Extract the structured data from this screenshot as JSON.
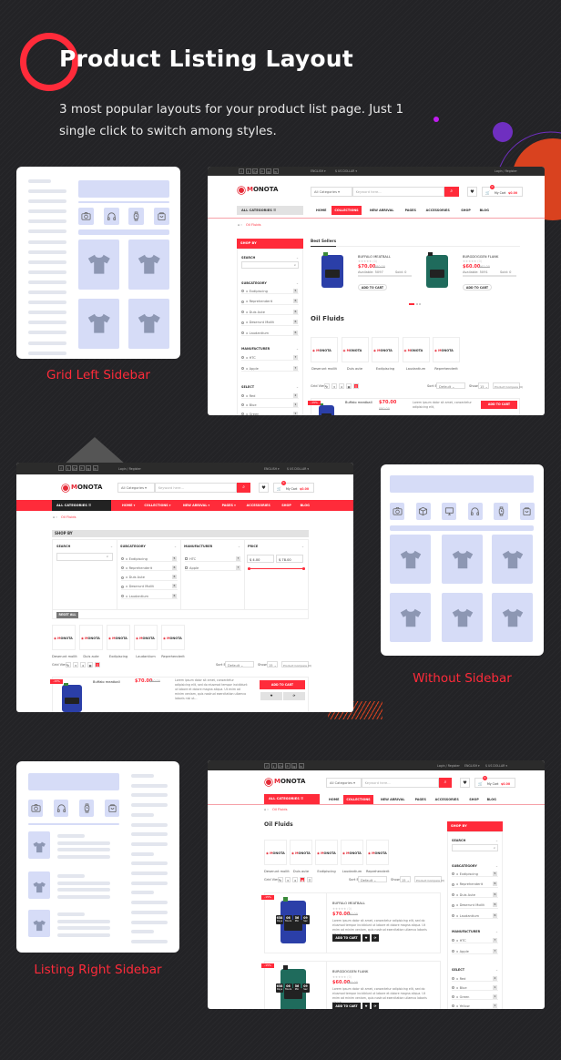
{
  "header": {
    "title": "Product Listing Layout",
    "subtitle": "3 most popular layouts for your product list page. Just 1 single click to switch among styles."
  },
  "colors": {
    "accent": "#ff2b3a",
    "wire": "#d6dcf7",
    "shirt": "#8d97b3",
    "purple": "#6f2fc0",
    "orange": "#d9421f"
  },
  "layouts": [
    {
      "label": "Grid Left Sidebar",
      "icons": [
        "camera-icon",
        "headphones-icon",
        "watch-icon",
        "bag-icon"
      ]
    },
    {
      "label": "Without Sidebar",
      "icons": [
        "camera-icon",
        "box-icon",
        "monitor-icon",
        "headphones-icon",
        "watch-icon",
        "bag-icon"
      ]
    },
    {
      "label": "Listing Right Sidebar",
      "icons": [
        "camera-icon",
        "headphones-icon",
        "watch-icon",
        "bag-icon"
      ]
    }
  ],
  "site": {
    "social": [
      "f",
      "t",
      "G+",
      "P",
      "ig",
      "in"
    ],
    "language": "ENGLISH",
    "currency": "$ US DOLLAR",
    "login": "Login / Register",
    "logo_m": "M",
    "logo_rest": "ONOTA",
    "category_select": "All Categories",
    "search_placeholder": "Keyword here...",
    "cart_label": "My Cart",
    "cart_total": "$0.00",
    "cart_count": "0",
    "all_categories": "ALL CATEGORIES",
    "nav": [
      "HOME",
      "COLLECTIONS",
      "NEW ARRIVAL",
      "PAGES",
      "ACCESSORIES",
      "SHOP",
      "BLOG"
    ],
    "breadcrumb": "Oil Fluids",
    "shop_by": "SHOP BY",
    "search": "SEARCH",
    "subcategory": "SUBCATEGORY",
    "manufacturer": "MANUFACTURER",
    "select": "SELECT",
    "price": "PRICE",
    "subcategories": [
      {
        "name": "Exdipiscing",
        "count": "5"
      },
      {
        "name": "Reprehenderit",
        "count": "6"
      },
      {
        "name": "Duis Aute",
        "count": "6"
      },
      {
        "name": "Deserunt Mollit",
        "count": "6"
      },
      {
        "name": "Laudantium",
        "count": "6"
      }
    ],
    "manufacturers": [
      {
        "name": "HTC",
        "count": "7"
      },
      {
        "name": "Apple",
        "count": "7"
      }
    ],
    "colors": [
      {
        "name": "Red",
        "count": "2"
      },
      {
        "name": "Blue",
        "count": "1"
      },
      {
        "name": "Green",
        "count": "1"
      },
      {
        "name": "Yellow",
        "count": "1"
      }
    ],
    "price_from": "$ 4.00",
    "price_to": "$ 78.00",
    "reset_all": "RESET ALL",
    "best_sellers": "Best Sellers",
    "page_title": "Oil Fluids",
    "brands_grid": [
      "Deserunt mollit",
      "Duis aute",
      "Exdipiscing",
      "Laudantium",
      "Reprehenderit"
    ],
    "grid_view": "Grid View:",
    "grid_options": [
      "2",
      "3",
      "4"
    ],
    "sort_by": "Sort By:",
    "sort_value": "Default",
    "show": "Show:",
    "show_value": "15",
    "compare": "Product Compare (0)",
    "add_to_cart": "ADD TO CART",
    "sale_badge": "-15%",
    "available_label": "Available:",
    "sold_label": "Sold:",
    "products": [
      {
        "name": "BUFFALO MEATBALL",
        "list_name": "Buffalo meatball",
        "price": "$70.00",
        "old_price": "$80.00",
        "rating_count": "(0)",
        "available": "5097",
        "sold": "0"
      },
      {
        "name": "BURGDOGGEN FLANK",
        "price": "$60.00",
        "old_price": "$61.00",
        "rating_count": "(0)",
        "available": "5091",
        "sold": "0"
      }
    ],
    "description_short": "Lorem ipsum dolor sit amet, consectetur adipisicing elit,",
    "description": "Lorem ipsum dolor sit amet, consectetur adipisicing elit, sed do eiusmod tempor incididunt ut labore et dolore magna aliqua. Ut enim ad minim veniam, quis nostrud exercitation ullamco laboris nisi ut...",
    "countdown": [
      {
        "v": "658",
        "u": "Days"
      },
      {
        "v": "06",
        "u": "Hours"
      },
      {
        "v": "56",
        "u": "Min"
      },
      {
        "v": "09",
        "u": "Sec"
      }
    ]
  }
}
